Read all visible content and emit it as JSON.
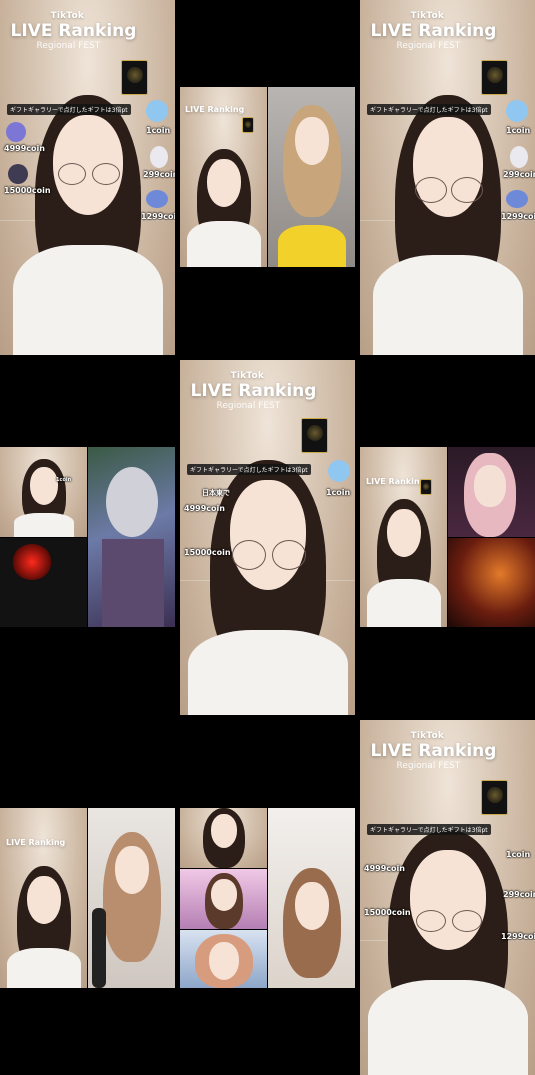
{
  "stream": {
    "brand": "TikTok",
    "title": "LIVE Ranking",
    "subtitle": "Regional FEST",
    "notice": "ギフトギャラリーで点灯したギフトは3倍pt",
    "region_note": "日本東で",
    "gifts": [
      {
        "label": "1coin",
        "color": "#8fc7f0"
      },
      {
        "label": "299coin",
        "color": "#e9e9ef"
      },
      {
        "label": "1299coin",
        "color": "#6e89d8"
      },
      {
        "label": "4999coin",
        "color": "#7c76d4"
      },
      {
        "label": "15000coin",
        "color": "#3e3b52"
      }
    ],
    "colors": {
      "room": "#d3c1ae",
      "hair": "#2b1d17",
      "skin": "#f6e3d6",
      "shirt": "#f4f2ef",
      "badge_gold": "#c9a94c",
      "black": "#000000"
    }
  }
}
